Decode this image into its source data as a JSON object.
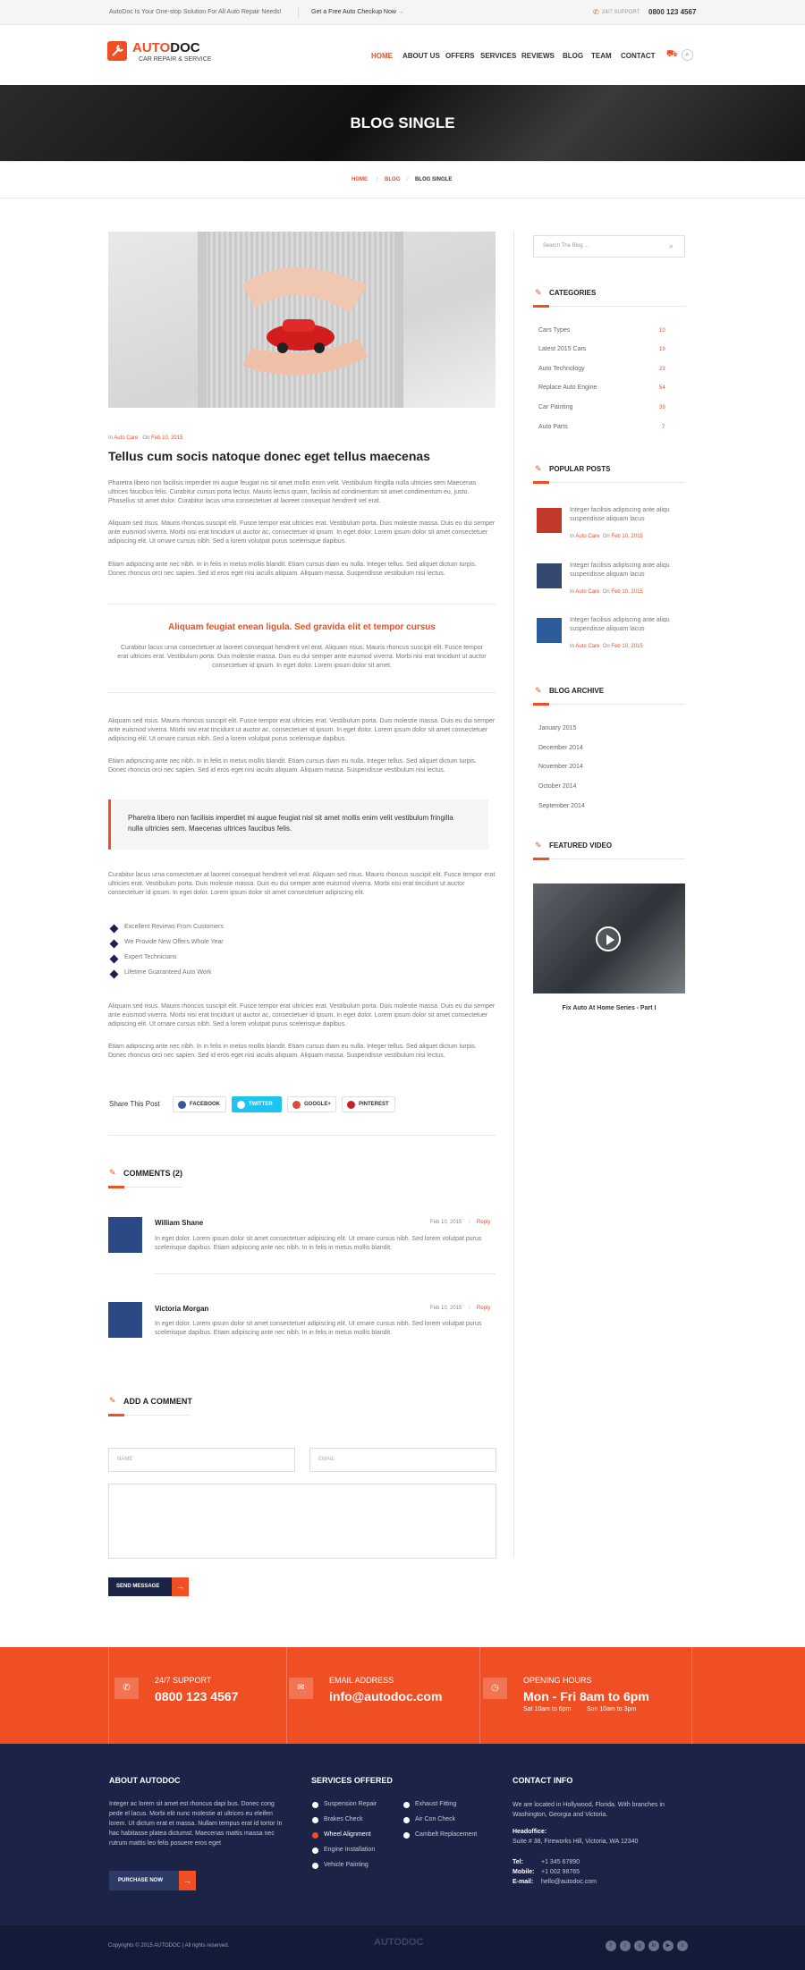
{
  "topbar": {
    "tagline": "AutoDoc Is Your One-stop Solution For All Auto Repair Needs!",
    "cta": "Get a Free Auto Checkup Now",
    "support_label": "24/7 SUPPORT",
    "support_phone": "0800 123 4567"
  },
  "logo": {
    "part1": "AUTO",
    "part2": "DOC",
    "sub": "CAR REPAIR & SERVICE"
  },
  "nav": [
    "HOME",
    "ABOUT US",
    "OFFERS",
    "SERVICES",
    "REVIEWS",
    "BLOG",
    "TEAM",
    "CONTACT"
  ],
  "banner": {
    "title": "BLOG SINGLE"
  },
  "breadcrumb": [
    "HOME",
    "BLOG",
    "BLOG SINGLE"
  ],
  "post": {
    "meta_in": "In",
    "category": "Auto Care",
    "meta_on": "On",
    "date": "Feb 10, 2015",
    "title": "Tellus cum socis natoque donec eget tellus maecenas",
    "p1": "Pharetra libero non facilisis imperdiet mi augue feugiat nis sit amet mollis enim velit. Vestibulum fringilla nulla ultricies sem Maecenas ultrices faucibus felis. Curabitur cursus porta lectus. Mauris lectus quam, facilisis ad condimentum sit amet condimentum eu, justo. Phasellus sit amet dolor. Curabitur lacus urna consectetuer at laoreet consequat hendrerit vel erat.",
    "p2": "Aliquam sed risus. Mauris rhoncus suscipit elit. Fusce tempor erat ultricies erat. Vestibulum porta. Duis molestie massa. Duis eu dui semper ante euismod viverra. Morbi nisi erat tincidunt ut auctor ac, consectetuer id ipsum. In eget dolor. Lorem ipsum dolor sit amet consectetuer adipiscing elit. Ut ornare cursus nibh. Sed a lorem volutpat purus scelerisque dapibus.",
    "p3": "Etiam adipiscing ante nec nibh. In in felis in metus mollis blandit. Etiam cursus diam eu nulla. Integer tellus. Sed aliquet dictum turpis. Donec rhoncus orci nec sapien. Sed id eros eget nisi iaculis aliquam. Aliquam massa. Suspendisse vestibulum nisi lectus.",
    "highlight_title": "Aliquam feugiat enean ligula. Sed gravida elit et tempor cursus",
    "highlight_text": "Curabitur lacus urna consectetuer at laoreet consequat hendrerit vel erat. Aliquam risus. Mauris rhoncus suscipit elit. Fusce tempor erat ultricies erat. Vestibulum porta. Duis molestie massa. Duis eu dui semper ante euismod viverra. Morbi nisi erat tincidunt ut auctor consectetuer id ipsum. In eget dolor. Lorem ipsum dolor sit amet.",
    "p4": "Aliquam sed risus. Mauris rhoncus suscipit elit. Fusce tempor erat ultricies erat. Vestibulum porta. Duis molestie massa. Duis eu dui semper ante euismod viverra. Morbi nisi erat tincidunt ut auctor ac, consectetuer id ipsum. In eget dolor. Lorem ipsum dolor sit amet consectetuer adipiscing elit. Ut ornare cursus nibh. Sed a lorem volutpat purus scelerisque dapibus.",
    "p5": "Etiam adipiscing ante nec nibh. In in felis in metus mollis blandit. Etiam cursus diam eu nulla. Integer tellus. Sed aliquet dictum turpis. Donec rhoncus orci nec sapien. Sed id eros eget nisi iaculis aliquam. Aliquam massa. Suspendisse vestibulum nisi lectus.",
    "blockquote": "Pharetra libero non facilisis imperdiet mi augue feugiat nisl sit amet mollis enim velit vestibulum fringilla nulla ultricies sem. Maecenas ultrices faucibus felis.",
    "p6": "Curabitur lacus urna consectetuer at laoreet consequat hendrerit vel erat. Aliquam sed risus. Mauris rhoncus suscipit elit. Fusce tempor erat ultricies erat. Vestibulum porta. Duis molestie massa. Duis eu dui semper ante euismod viverra. Morbi nisi erat tincidunt ut auctor consectetuer id ipsum. In eget dolor. Lorem ipsum dolor sit amet consectetuer adipiscing elit.",
    "list": [
      "Excellent Reviews From Customers",
      "We Provide New Offers Whole Year",
      "Expert Technicians",
      "Lifetime Guaranteed Auto Work"
    ],
    "p7": "Aliquam sed risus. Mauris rhoncus suscipit elit. Fusce tempor erat ultricies erat. Vestibulum porta. Duis molestie massa. Duis eu dui semper ante euismod viverra. Morbi nisi erat tincidunt ut auctor ac, consectetuer id ipsum. In eget dolor. Lorem ipsum dolor sit amet consectetuer adipiscing elit. Ut ornare cursus nibh. Sed a lorem volutpat purus scelerisque dapibus.",
    "p8": "Etiam adipiscing ante nec nibh. In in felis in metus mollis blandit. Etiam cursus diam eu nulla. Integer tellus. Sed aliquet dictum turpis. Donec rhoncus orci nec sapien. Sed id eros eget nisi iaculis aliquam. Aliquam massa. Suspendisse vestibulum nisi lectus."
  },
  "share": {
    "label": "Share This Post",
    "facebook": "FACEBOOK",
    "twitter": "TWITTER",
    "google": "GOOGLE+",
    "pinterest": "PINTEREST"
  },
  "comments": {
    "heading": "COMMENTS (2)",
    "items": [
      {
        "name": "William Shane",
        "date": "Feb 10, 2015",
        "reply": "Reply",
        "text": "In eget dolor. Lorem ipsum dolor sit amet consectetuer adipiscing elit. Ut ornare cursus nibh. Sed lorem volutpat purus scelerisque dapibus. Etiam adipiscing ante nec nibh. In in felis in metus mollis blandit."
      },
      {
        "name": "Victoria Morgan",
        "date": "Feb 10, 2015",
        "reply": "Reply",
        "text": "In eget dolor. Lorem ipsum dolor sit amet consectetuer adipiscing elit. Ut ornare cursus nibh. Sed lorem volutpat purus scelerisque dapibus. Etiam adipiscing ante nec nibh. In in felis in metus mollis blandit."
      }
    ]
  },
  "form": {
    "heading": "ADD A COMMENT",
    "name_ph": "NAME",
    "email_ph": "EMAIL",
    "submit": "SEND MESSAGE"
  },
  "sidebar": {
    "search_ph": "Search The Blog ...",
    "categories_h": "CATEGORIES",
    "categories": [
      {
        "name": "Cars Types",
        "count": "10"
      },
      {
        "name": "Latest 2015 Cars",
        "count": "19"
      },
      {
        "name": "Auto Technology",
        "count": "23"
      },
      {
        "name": "Replace Auto Engine",
        "count": "54"
      },
      {
        "name": "Car Painting",
        "count": "39"
      },
      {
        "name": "Auto Parts",
        "count": "7"
      }
    ],
    "popular_h": "POPULAR POSTS",
    "popular": [
      {
        "text": "Integer facilisis adipiscing ante aliqu suspendisse aliquam lacus",
        "in": "In",
        "cat": "Auto Care",
        "on": "On",
        "date": "Feb 10, 2015"
      },
      {
        "text": "Integer facilisis adipiscing ante aliqu suspendisse aliquam lacus",
        "in": "In",
        "cat": "Auto Care",
        "on": "On",
        "date": "Feb 10, 2015"
      },
      {
        "text": "Integer facilisis adipiscing ante aliqu suspendisse aliquam lacus",
        "in": "In",
        "cat": "Auto Care",
        "on": "On",
        "date": "Feb 10, 2015"
      }
    ],
    "archive_h": "BLOG ARCHIVE",
    "archive": [
      "January 2015",
      "December 2014",
      "November 2014",
      "October 2014",
      "September 2014"
    ],
    "video_h": "FEATURED VIDEO",
    "video_title": "Fix Auto At Home Series - Part I"
  },
  "contact_bar": [
    {
      "label": "24/7 SUPPORT",
      "value": "0800 123 4567",
      "icon": "phone-icon"
    },
    {
      "label": "EMAIL ADDRESS",
      "value": "info@autodoc.com",
      "icon": "mail-icon"
    },
    {
      "label": "OPENING HOURS",
      "value": "Mon - Fri  8am to 6pm",
      "sub1": "Sat 10am to 6pm",
      "sub2": "Sun 10am to 3pm",
      "icon": "clock-icon"
    }
  ],
  "footer": {
    "about_h": "ABOUT AUTODOC",
    "about_text": "Integer ac lorem sit amet est rhoncus dapi bus. Donec cong pede el lacus. Morbi elit nunc molestie at ultrices eu eleifen lorem. Ut dictum erat et massa. Nullam tempus erat id tortor In hac habitasse platea dictumst. Maecenas mattis massa nec rutrum mattis leo felis posuere eros eget",
    "purchase": "PURCHASE NOW",
    "services_h": "SERVICES OFFERED",
    "services_col1": [
      "Suspension Repair",
      "Brakes Check",
      "Wheel Alignment",
      "Engine Installation",
      "Vehicle Painting"
    ],
    "services_col2": [
      "Exhaust Fitting",
      "Air Con Check",
      "Cambelt Replacement"
    ],
    "contact_h": "CONTACT INFO",
    "contact_text": "We are located in Hollywood, Florida. With branches in Washington, Georgia and Victoria.",
    "office_label": "Headoffice:",
    "office": "Suite # 38, Fireworks Hill, Victoria, WA 12340",
    "tel_label": "Tel:",
    "tel": "+1 345 67890",
    "mobile_label": "Mobile:",
    "mobile": "+1 002 98765",
    "email_label": "E-mail:",
    "email": "hello@autodoc.com",
    "copyright": "Copyrights © 2015 AUTODOC  |  All rights reserved."
  },
  "colors": {
    "accent": "#f04e23",
    "navy": "#1b2447"
  }
}
